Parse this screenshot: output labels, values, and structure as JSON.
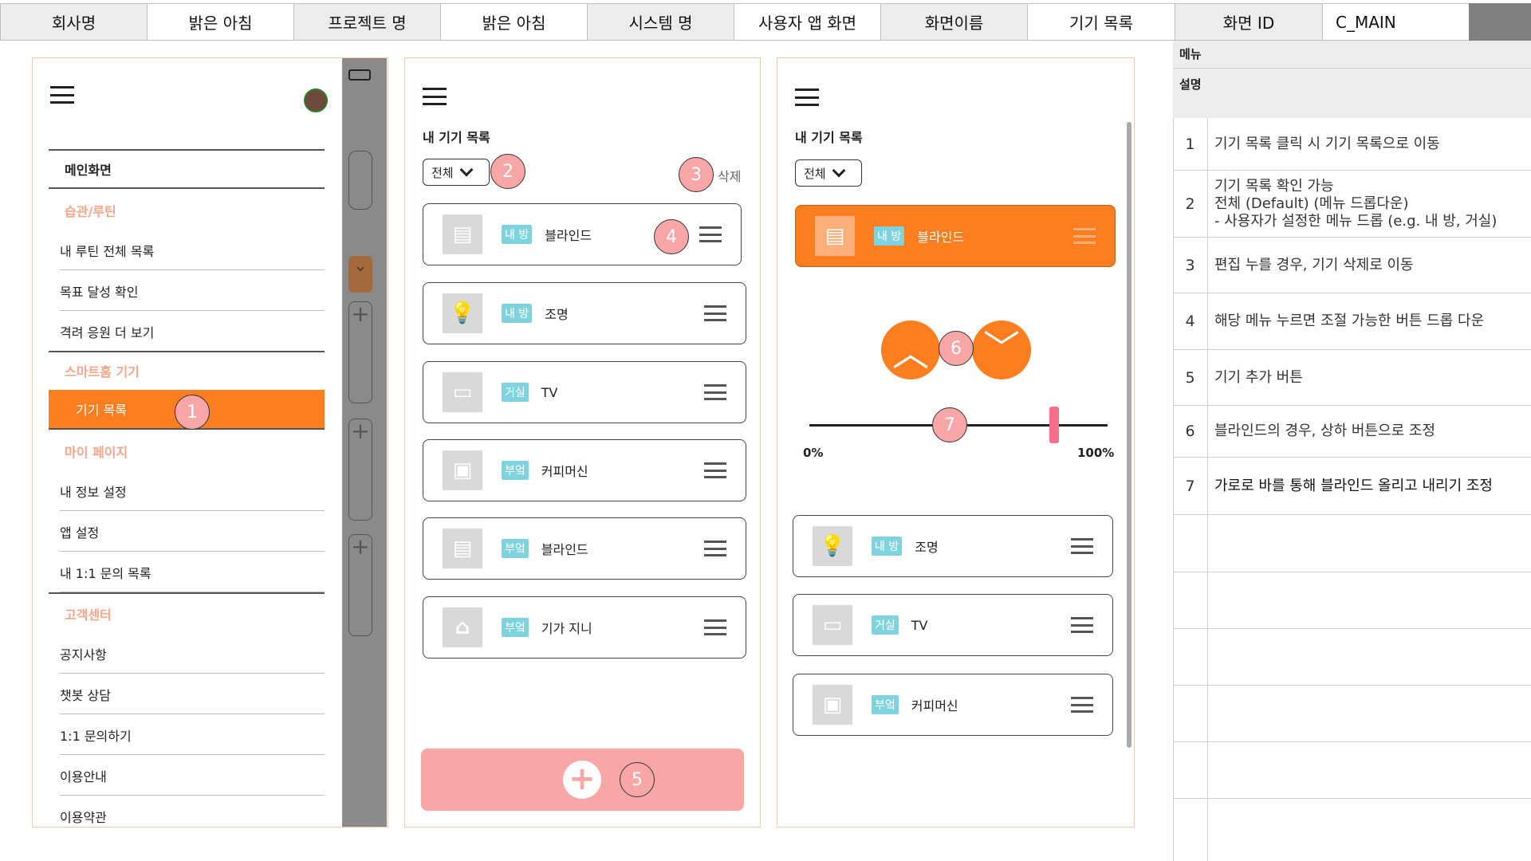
{
  "header": {
    "company_label": "회사명",
    "company_value": "밝은 아침",
    "project_label": "프로젝트 명",
    "project_value": "밝은 아침",
    "system_label": "시스템 명",
    "system_value": "사용자 앱 화면",
    "screen_name_label": "화면이름",
    "screen_name_value": "기기 목록",
    "screen_id_label": "화면 ID",
    "screen_id_value": "C_MAIN"
  },
  "side_menu": {
    "main": "메인화면",
    "cat_habit": "습관/루틴",
    "habit_items": [
      "내 루틴 전체 목록",
      "목표 달성 확인",
      "격려 응원 더 보기"
    ],
    "cat_smarthome": "스마트홈 기기",
    "active_item": "기기 목록",
    "cat_mypage": "마이 페이지",
    "mypage_items": [
      "내 정보 설정",
      "앱 설정",
      "내 1:1 문의 목록"
    ],
    "cat_support": "고객센터",
    "support_items": [
      "공지사항",
      "챗봇 상담",
      "1:1 문의하기",
      "이용안내",
      "이용약관"
    ]
  },
  "list_screen": {
    "title": "내 기기 목록",
    "filter": "전체",
    "delete": "삭제",
    "devices": [
      {
        "room": "내 방",
        "name": "블라인드",
        "icon": "blind-icon"
      },
      {
        "room": "내 방",
        "name": "조명",
        "icon": "bulb-icon"
      },
      {
        "room": "거실",
        "name": "TV",
        "icon": "tv-icon"
      },
      {
        "room": "부엌",
        "name": "커피머신",
        "icon": "coffee-machine-icon"
      },
      {
        "room": "부엌",
        "name": "블라인드",
        "icon": "blind-icon"
      },
      {
        "room": "부엌",
        "name": "기가 지니",
        "icon": "smart-speaker-icon"
      }
    ]
  },
  "control_screen": {
    "title": "내 기기 목록",
    "filter": "전체",
    "selected": {
      "room": "내 방",
      "name": "블라인드"
    },
    "slider_min": "0%",
    "slider_max": "100%",
    "slider_value": 0.82,
    "devices": [
      {
        "room": "내 방",
        "name": "조명"
      },
      {
        "room": "거실",
        "name": "TV"
      },
      {
        "room": "부엌",
        "name": "커피머신"
      }
    ]
  },
  "callouts": [
    "1",
    "2",
    "3",
    "4",
    "5",
    "6",
    "7"
  ],
  "desc_table": {
    "menu_label": "메뉴",
    "desc_label": "설명",
    "rows": [
      {
        "num": "1",
        "text": "기기 목록 클릭 시 기기 목록으로 이동"
      },
      {
        "num": "2",
        "text": "기기 목록 확인 가능\n전체 (Default) (메뉴 드롭다운)\n- 사용자가 설정한 메뉴 드롭 (e.g. 내 방, 거실)"
      },
      {
        "num": "3",
        "text": "편집 누를 경우, 기기 삭제로 이동"
      },
      {
        "num": "4",
        "text": "해당 메뉴 누르면 조절 가능한 버튼 드롭 다운"
      },
      {
        "num": "5",
        "text": "기기 추가 버튼"
      },
      {
        "num": "6",
        "text": "블라인드의 경우, 상하 버튼으로 조정"
      },
      {
        "num": "7",
        "text": "가로로 바를 통해 블라인드 올리고 내리기 조정"
      }
    ]
  },
  "colors": {
    "accent": "#fd7e1e",
    "callout": "#f9a6a6",
    "room_badge": "#7fd3df",
    "add_button": "#f9a6a6"
  }
}
